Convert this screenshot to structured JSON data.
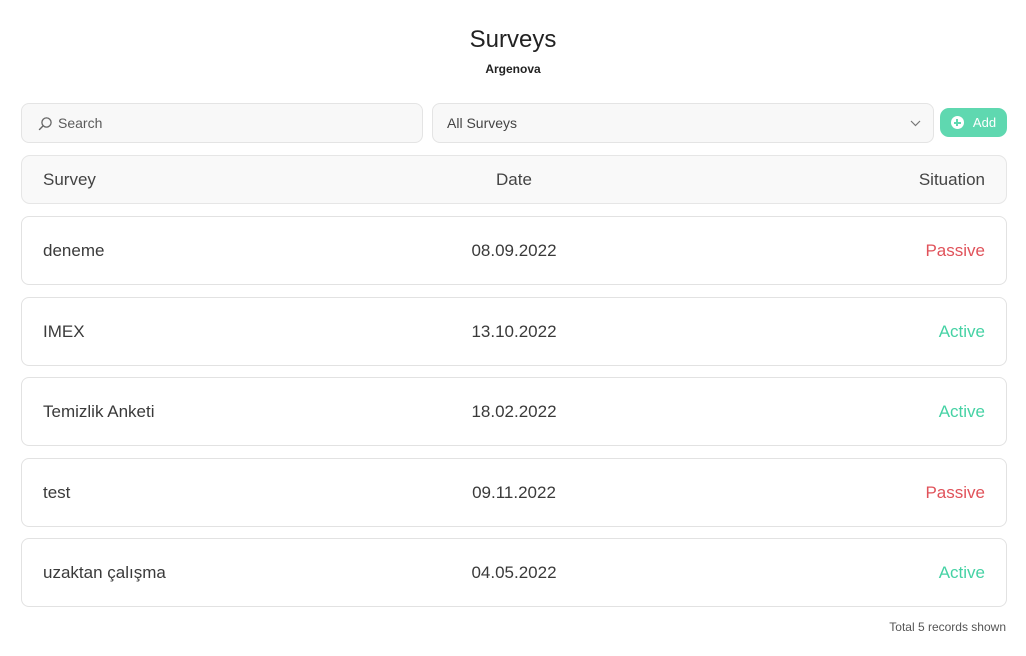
{
  "header": {
    "title": "Surveys",
    "subtitle": "Argenova"
  },
  "toolbar": {
    "search_placeholder": "Search",
    "search_value": "",
    "filter_selected": "All Surveys",
    "add_label": "Add"
  },
  "colors": {
    "accent": "#5fd8b0",
    "active": "#45d2a4",
    "passive": "#e0525a"
  },
  "table": {
    "columns": [
      "Survey",
      "Date",
      "Situation"
    ],
    "rows": [
      {
        "survey": "deneme",
        "date": "08.09.2022",
        "situation": "Passive"
      },
      {
        "survey": "IMEX",
        "date": "13.10.2022",
        "situation": "Active"
      },
      {
        "survey": "Temizlik Anketi",
        "date": "18.02.2022",
        "situation": "Active"
      },
      {
        "survey": "test",
        "date": "09.11.2022",
        "situation": "Passive"
      },
      {
        "survey": "uzaktan çalışma",
        "date": "04.05.2022",
        "situation": "Active"
      }
    ]
  },
  "footer": {
    "records_text": "Total 5 records shown"
  }
}
